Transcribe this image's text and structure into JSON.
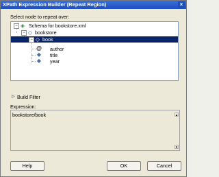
{
  "window": {
    "title": "XPath Expression Builder (Repeat Region)",
    "close": "×"
  },
  "labels": {
    "select_node": "Select node to repeat over:",
    "build_filter": "Build Filter",
    "expression": "Expression:"
  },
  "tree": {
    "root": "Schema for bookstore.xml",
    "bookstore": "bookstore",
    "book": "book",
    "children": [
      "author",
      "title",
      "year"
    ]
  },
  "expression_value": "bookstore/book",
  "buttons": {
    "help": "Help",
    "ok": "OK",
    "cancel": "Cancel"
  },
  "icons": {
    "root": "document-icon",
    "element": "element-icon",
    "attribute": "attribute-icon",
    "expand_arrow": "▷"
  },
  "colors": {
    "selection": "#0a246a",
    "titlebar": "#2a5dcb"
  }
}
